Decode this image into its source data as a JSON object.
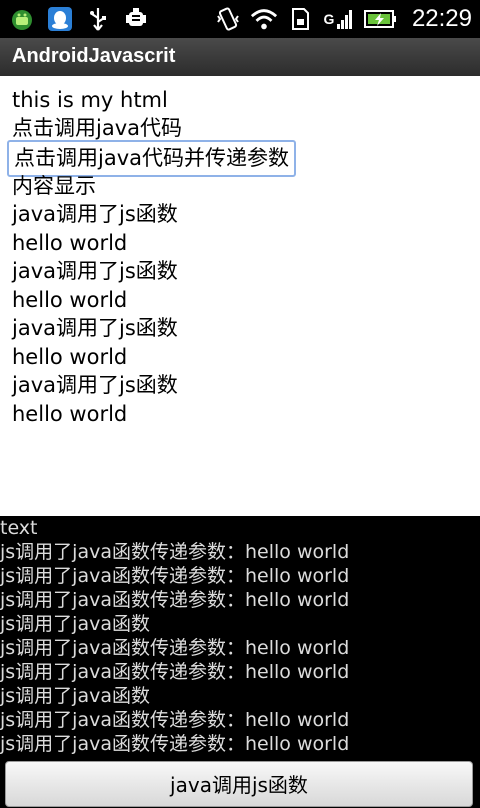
{
  "status_bar": {
    "time": "22:29",
    "left_icons": [
      "android-notification-icon",
      "qq-icon",
      "usb-icon",
      "debug-android-icon"
    ],
    "right_icons": [
      "vibrate-icon",
      "wifi-icon",
      "sd-card-icon",
      "signal-g-icon",
      "battery-charging-icon"
    ],
    "network_label": "G"
  },
  "title_bar": {
    "title": "AndroidJavascrit"
  },
  "webview": {
    "lines": [
      {
        "text": "this is my html"
      },
      {
        "text": "点击调用java代码"
      },
      {
        "text": "点击调用java代码并传递参数"
      },
      {
        "text": "内容显示"
      },
      {
        "text": "java调用了js函数"
      },
      {
        "text": "hello world"
      },
      {
        "text": "java调用了js函数"
      },
      {
        "text": "hello world"
      },
      {
        "text": "java调用了js函数"
      },
      {
        "text": "hello world"
      },
      {
        "text": "java调用了js函数"
      },
      {
        "text": "hello world"
      }
    ]
  },
  "log": {
    "lines": [
      "text",
      "js调用了java函数传递参数：hello world",
      "js调用了java函数传递参数：hello world",
      "js调用了java函数传递参数：hello world",
      "js调用了java函数",
      "js调用了java函数传递参数：hello world",
      "js调用了java函数传递参数：hello world",
      "js调用了java函数",
      "js调用了java函数传递参数：hello world",
      "js调用了java函数传递参数：hello world"
    ]
  },
  "bottom_button": {
    "label": "java调用js函数"
  },
  "colors": {
    "focus_border": "#8fb2e8",
    "battery_green": "#6ac33b"
  }
}
